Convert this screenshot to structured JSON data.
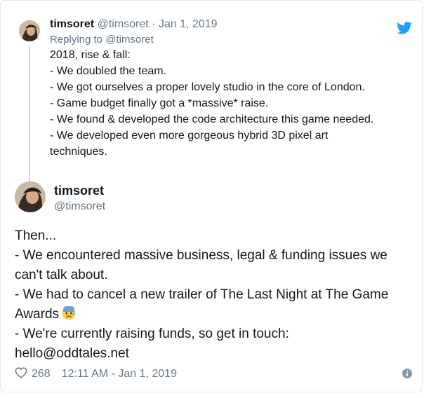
{
  "parent_tweet": {
    "name": "timsoret",
    "handle": "@timsoret",
    "separator": "·",
    "date": "Jan 1, 2019",
    "replying_to": "Replying to @timsoret",
    "lines": [
      "2018, rise & fall:",
      "- We doubled the team.",
      "- We got ourselves a proper lovely studio in the core of London.",
      "- Game budget finally got a *massive* raise.",
      "- We found & developed the code architecture this game needed.",
      "- We developed even more gorgeous hybrid 3D pixel art",
      "techniques."
    ]
  },
  "main_tweet": {
    "name": "timsoret",
    "handle": "@timsoret",
    "lines": [
      "Then...",
      "- We encountered massive business, legal & funding issues we",
      "can't talk about.",
      "- We had to cancel a new trailer of The Last Night at The Game",
      "Awards",
      "- We're currently raising funds, so get in touch:",
      "hello@oddtales.net"
    ],
    "emoji": "anxious-face-with-sweat"
  },
  "footer": {
    "likes": "268",
    "timestamp": "12:11 AM - Jan 1, 2019"
  },
  "colors": {
    "twitter_blue": "#1da1f2",
    "muted": "#657786",
    "text": "#14171a",
    "border": "#e1e8ed"
  }
}
